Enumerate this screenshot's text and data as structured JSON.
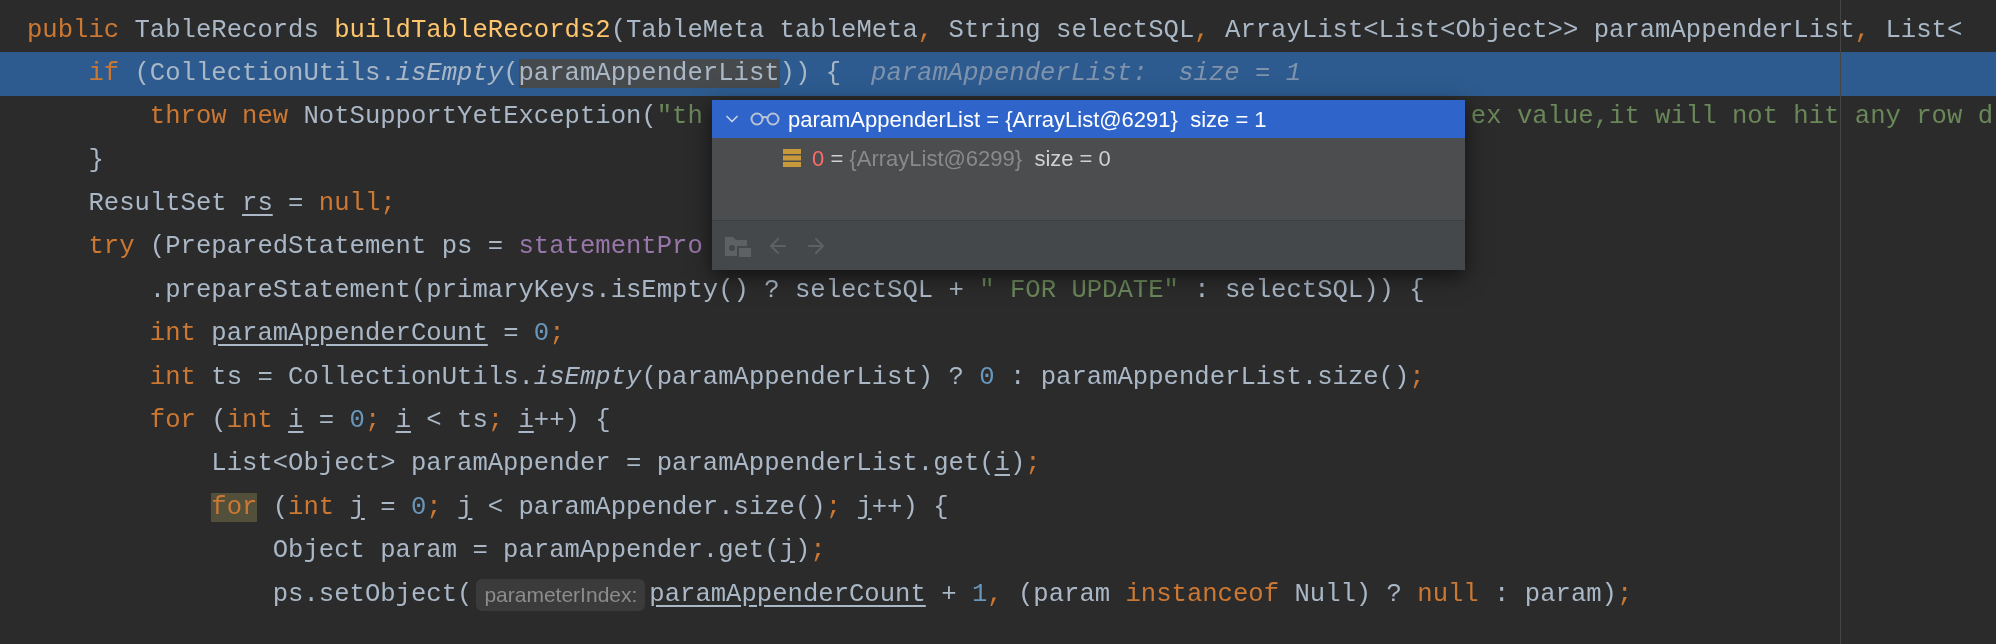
{
  "editor": {
    "lines": [
      {
        "current": false,
        "segments": [
          {
            "kind": "code",
            "tokens": [
              {
                "kind": "keyword",
                "text": "public"
              },
              {
                "kind": "plain",
                "text": " TableRecords "
              },
              {
                "kind": "declaration",
                "text": "buildTableRecords2"
              },
              {
                "kind": "plain",
                "text": "(TableMeta tableMeta"
              },
              {
                "kind": "punct",
                "text": ","
              },
              {
                "kind": "plain",
                "text": " String selectSQL"
              },
              {
                "kind": "punct",
                "text": ","
              },
              {
                "kind": "plain",
                "text": " ArrayList<List<Object>> paramAppenderList"
              },
              {
                "kind": "punct",
                "text": ","
              },
              {
                "kind": "plain",
                "text": " List<"
              }
            ]
          }
        ]
      },
      {
        "current": true,
        "segments": [
          {
            "kind": "code",
            "tokens": [
              {
                "kind": "keyword",
                "text": "    if"
              },
              {
                "kind": "plain",
                "text": " (CollectionUtils."
              },
              {
                "kind": "static-call",
                "text": "isEmpty"
              },
              {
                "kind": "plain",
                "text": "("
              },
              {
                "kind": "selected-ref",
                "text": "paramAppenderList"
              },
              {
                "kind": "plain",
                "text": ")) {"
              }
            ]
          },
          {
            "kind": "inline-value",
            "text": "paramAppenderList:  size = 1"
          }
        ]
      },
      {
        "current": false,
        "segments": [
          {
            "kind": "code",
            "tokens": [
              {
                "kind": "keyword",
                "text": "        throw new"
              },
              {
                "kind": "plain",
                "text": " NotSupportYetException("
              },
              {
                "kind": "string",
                "text": "\"th"
              }
            ]
          },
          {
            "kind": "covered"
          },
          {
            "kind": "code",
            "tokens": [
              {
                "kind": "string",
                "text": "ex value,it will not hit any row d"
              }
            ]
          }
        ]
      },
      {
        "current": false,
        "segments": [
          {
            "kind": "code",
            "tokens": [
              {
                "kind": "plain",
                "text": "    }"
              }
            ]
          }
        ]
      },
      {
        "current": false,
        "segments": [
          {
            "kind": "code",
            "tokens": [
              {
                "kind": "plain",
                "text": "    ResultSet "
              },
              {
                "kind": "reassigned",
                "text": "rs"
              },
              {
                "kind": "plain",
                "text": " = "
              },
              {
                "kind": "keyword",
                "text": "null"
              },
              {
                "kind": "punct",
                "text": ";"
              }
            ]
          }
        ]
      },
      {
        "current": false,
        "segments": [
          {
            "kind": "code",
            "tokens": [
              {
                "kind": "keyword",
                "text": "    try"
              },
              {
                "kind": "plain",
                "text": " (PreparedStatement ps = "
              },
              {
                "kind": "field",
                "text": "statementPro"
              }
            ]
          }
        ]
      },
      {
        "current": false,
        "segments": [
          {
            "kind": "code",
            "tokens": [
              {
                "kind": "plain",
                "text": "        .prepareStatement(primaryKeys.isEmpty() ? selectSQL + "
              },
              {
                "kind": "string",
                "text": "\" FOR UPDATE\""
              },
              {
                "kind": "plain",
                "text": " : selectSQL)) {"
              }
            ]
          }
        ]
      },
      {
        "current": false,
        "segments": [
          {
            "kind": "code",
            "tokens": [
              {
                "kind": "keyword",
                "text": "        int "
              },
              {
                "kind": "reassigned",
                "text": "paramAppenderCount"
              },
              {
                "kind": "plain",
                "text": " = "
              },
              {
                "kind": "number",
                "text": "0"
              },
              {
                "kind": "punct",
                "text": ";"
              }
            ]
          }
        ]
      },
      {
        "current": false,
        "segments": [
          {
            "kind": "code",
            "tokens": [
              {
                "kind": "keyword",
                "text": "        int"
              },
              {
                "kind": "plain",
                "text": " ts = CollectionUtils."
              },
              {
                "kind": "static-call",
                "text": "isEmpty"
              },
              {
                "kind": "plain",
                "text": "(paramAppenderList) ? "
              },
              {
                "kind": "number",
                "text": "0"
              },
              {
                "kind": "plain",
                "text": " : paramAppenderList.size()"
              },
              {
                "kind": "punct",
                "text": ";"
              }
            ]
          }
        ]
      },
      {
        "current": false,
        "segments": [
          {
            "kind": "code",
            "tokens": [
              {
                "kind": "keyword",
                "text": "        for"
              },
              {
                "kind": "plain",
                "text": " ("
              },
              {
                "kind": "keyword",
                "text": "int "
              },
              {
                "kind": "reassigned",
                "text": "i"
              },
              {
                "kind": "plain",
                "text": " = "
              },
              {
                "kind": "number",
                "text": "0"
              },
              {
                "kind": "punct",
                "text": "; "
              },
              {
                "kind": "reassigned",
                "text": "i"
              },
              {
                "kind": "plain",
                "text": " < ts"
              },
              {
                "kind": "punct",
                "text": "; "
              },
              {
                "kind": "reassigned",
                "text": "i"
              },
              {
                "kind": "plain",
                "text": "++) {"
              }
            ]
          }
        ]
      },
      {
        "current": false,
        "segments": [
          {
            "kind": "code",
            "tokens": [
              {
                "kind": "plain",
                "text": "            List<Object> paramAppender = paramAppenderList.get("
              },
              {
                "kind": "reassigned",
                "text": "i"
              },
              {
                "kind": "plain",
                "text": ")"
              },
              {
                "kind": "punct",
                "text": ";"
              }
            ]
          }
        ]
      },
      {
        "current": false,
        "segments": [
          {
            "kind": "code",
            "tokens": [
              {
                "kind": "usage-keyword",
                "text": "            for"
              },
              {
                "kind": "plain",
                "text": " ("
              },
              {
                "kind": "keyword",
                "text": "int "
              },
              {
                "kind": "reassigned",
                "text": "j"
              },
              {
                "kind": "plain",
                "text": " = "
              },
              {
                "kind": "number",
                "text": "0"
              },
              {
                "kind": "punct",
                "text": "; "
              },
              {
                "kind": "reassigned",
                "text": "j"
              },
              {
                "kind": "plain",
                "text": " < paramAppender.size()"
              },
              {
                "kind": "punct",
                "text": "; "
              },
              {
                "kind": "reassigned",
                "text": "j"
              },
              {
                "kind": "plain",
                "text": "++) {"
              }
            ]
          }
        ]
      },
      {
        "current": false,
        "segments": [
          {
            "kind": "code",
            "tokens": [
              {
                "kind": "plain",
                "text": "                Object param = paramAppender.get("
              },
              {
                "kind": "reassigned",
                "text": "j"
              },
              {
                "kind": "plain",
                "text": ")"
              },
              {
                "kind": "punct",
                "text": ";"
              }
            ]
          }
        ]
      },
      {
        "current": false,
        "segments": [
          {
            "kind": "code",
            "tokens": [
              {
                "kind": "plain",
                "text": "                ps.setObject("
              }
            ]
          },
          {
            "kind": "parameter-hint",
            "text": "parameterIndex:"
          },
          {
            "kind": "code",
            "tokens": [
              {
                "kind": "reassigned",
                "text": "paramAppenderCount"
              },
              {
                "kind": "plain",
                "text": " + "
              },
              {
                "kind": "number",
                "text": "1"
              },
              {
                "kind": "punct",
                "text": ","
              },
              {
                "kind": "plain",
                "text": " (param "
              },
              {
                "kind": "keyword",
                "text": "instanceof"
              },
              {
                "kind": "plain",
                "text": " Null) ? "
              },
              {
                "kind": "keyword",
                "text": "null"
              },
              {
                "kind": "plain",
                "text": " : param)"
              },
              {
                "kind": "punct",
                "text": ";"
              }
            ]
          }
        ]
      }
    ]
  },
  "debug_popup": {
    "rows": [
      {
        "expanded": true,
        "selected": true,
        "name": "paramAppenderList",
        "separator": "=",
        "value": "{ArrayList@6291}",
        "size": "size = 1",
        "children": [
          {
            "selected": false,
            "name": "0",
            "separator": "=",
            "value": "{ArrayList@6299}",
            "size": "size = 0"
          }
        ]
      }
    ]
  }
}
